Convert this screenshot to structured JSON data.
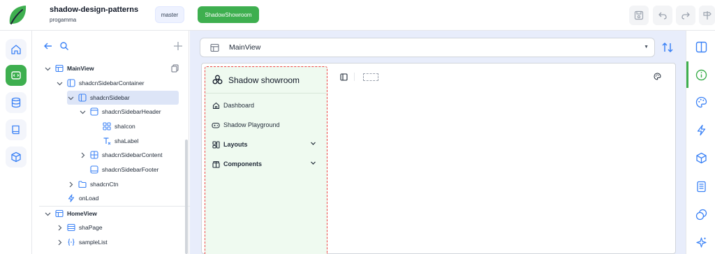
{
  "header": {
    "project_title": "shadow-design-patterns",
    "project_owner": "progamma",
    "branch_label": "master",
    "app_button_label": "ShadowShowroom",
    "actions": [
      "save-icon",
      "undo-icon",
      "redo-icon",
      "sign-icon"
    ]
  },
  "left_rail": {
    "items": [
      "home-icon",
      "views-icon",
      "database-icon",
      "book-icon",
      "package-icon"
    ],
    "active": "views-icon"
  },
  "tree": {
    "rows": [
      {
        "label": "MainView",
        "expanded": true,
        "icon": "view-icon"
      },
      {
        "label": "shadcnSidebarContainer",
        "expanded": true,
        "icon": "sidebar-container-icon"
      },
      {
        "label": "shadcnSidebar",
        "expanded": true,
        "icon": "sidebar-icon",
        "selected": true
      },
      {
        "label": "shadcnSidebarHeader",
        "expanded": true,
        "icon": "header-icon"
      },
      {
        "label": "shaIcon",
        "icon": "grid-icon"
      },
      {
        "label": "shaLabel",
        "icon": "text-icon"
      },
      {
        "label": "shadcnSidebarContent",
        "expanded": false,
        "icon": "content-icon"
      },
      {
        "label": "shadcnSidebarFooter",
        "icon": "footer-icon"
      },
      {
        "label": "shadcnCtn",
        "expanded": false,
        "icon": "folder-icon"
      },
      {
        "label": "onLoad",
        "icon": "bolt-icon"
      },
      {
        "label": "HomeView",
        "expanded": true,
        "icon": "view-icon"
      },
      {
        "label": "shaPage",
        "expanded": false,
        "icon": "page-icon"
      },
      {
        "label": "sampleList",
        "expanded": false,
        "icon": "braces-icon"
      }
    ]
  },
  "editor": {
    "selected_view": "MainView"
  },
  "preview": {
    "sidebar_title": "Shadow showroom",
    "nav_items": [
      {
        "label": "Dashboard",
        "icon": "home-icon",
        "group": false
      },
      {
        "label": "Shadow Playground",
        "icon": "gamepad-icon",
        "group": false
      },
      {
        "label": "Layouts",
        "icon": "layout-icon",
        "group": true
      },
      {
        "label": "Components",
        "icon": "box-icon",
        "group": true
      }
    ]
  },
  "right_rail": {
    "items": [
      "panel-icon",
      "info-icon",
      "palette-icon",
      "bolt-icon",
      "cube-icon",
      "document-icon",
      "layers-icon",
      "sparkle-icon"
    ],
    "active": "info-icon"
  },
  "colors": {
    "accent": "#3eaf4f",
    "selection": "#dde5f7",
    "canvas_bg": "#e8edfb",
    "sidebar_bg": "#effaf0",
    "dashed_outline": "#ef4444",
    "icon_blue": "#3b82f6"
  }
}
